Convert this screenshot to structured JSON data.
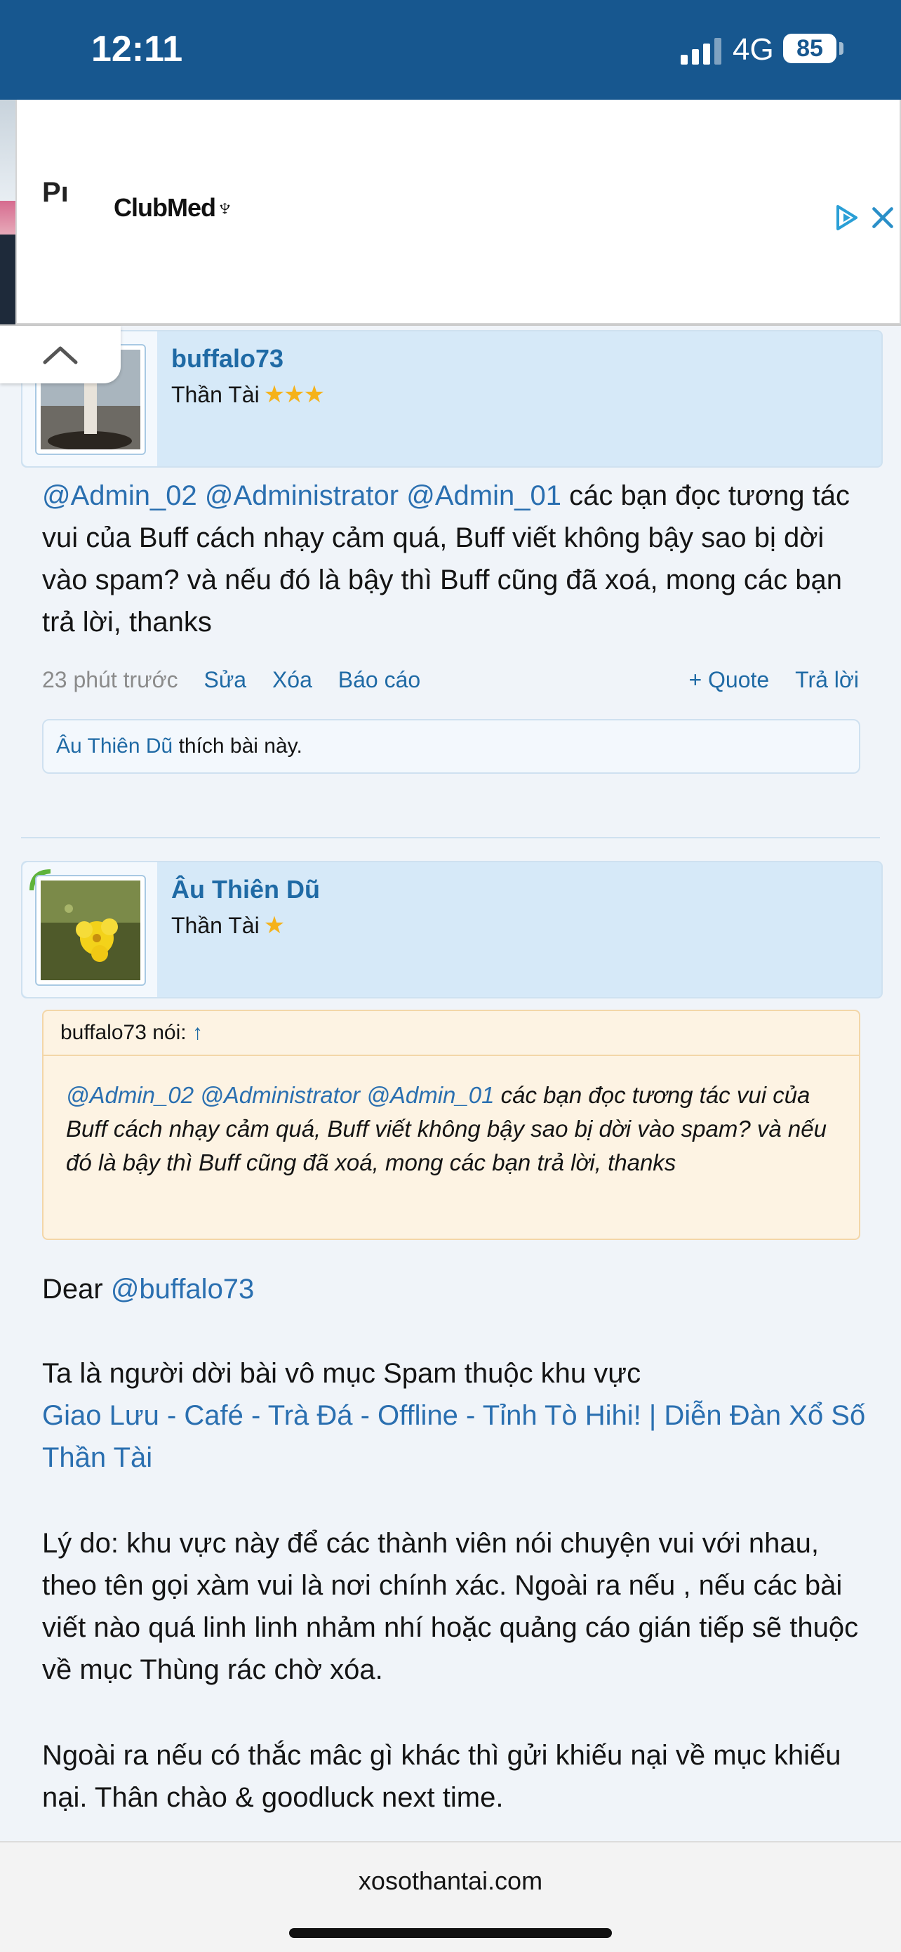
{
  "status_bar": {
    "time": "12:11",
    "network": "4G",
    "battery": "85"
  },
  "ad": {
    "partial_text": "Pı",
    "brand": "ClubMed",
    "brand_symbol": "♆"
  },
  "post1": {
    "username": "buffalo73",
    "rank": "Thần Tài",
    "rank_stars": "★★★",
    "mentions": [
      "@Admin_02",
      "@Administrator",
      "@Admin_01"
    ],
    "text": "các bạn đọc tương tác vui của Buff cách nhạy cảm quá, Buff viết không bậy sao bị dời vào spam? và nếu đó là bậy thì Buff cũng đã xoá, mong các bạn trả lời, thanks",
    "time": "23 phút trước",
    "actions": [
      "Sửa",
      "Xóa",
      "Báo cáo"
    ],
    "right_actions": [
      "+ Quote",
      "Trả lời"
    ],
    "liked_by": "Âu Thiên Dũ",
    "liked_suffix": "thích bài này."
  },
  "post2": {
    "username": "Âu Thiên Dũ",
    "rank": "Thần Tài",
    "rank_stars": "★",
    "quote_author": "buffalo73 nói:",
    "quote_arrow": "↑",
    "quote_mentions": [
      "@Admin_02",
      "@Administrator",
      "@Admin_01"
    ],
    "quote_text": "các bạn đọc tương tác vui của Buff cách nhạy cảm quá, Buff viết không bậy sao bị dời vào spam? và nếu đó là bậy thì Buff cũng đã xoá, mong các bạn trả lời, thanks",
    "greeting": "Dear",
    "greeting_mention": "@buffalo73",
    "para1": "Ta là người dời bài vô mục Spam thuộc khu vực",
    "para1_link": "Giao Lưu - Café - Trà Đá - Offline - Tỉnh Tò Hihi! | Diễn Đàn Xổ Số Thần Tài",
    "para2": "Lý do: khu vực này để các thành viên nói chuyện vui với nhau, theo tên gọi xàm vui là nơi chính xác. Ngoài ra nếu , nếu các bài viết nào quá linh linh nhảm nhí hoặc quảng cáo gián tiếp sẽ thuộc về mục Thùng rác chờ xóa.",
    "para3": "Ngoài ra nếu có thắc mâc gì khác thì gửi khiếu nại về mục khiếu nại. Thân chào & goodluck next time."
  },
  "browser": {
    "domain": "xosothantai.com"
  }
}
